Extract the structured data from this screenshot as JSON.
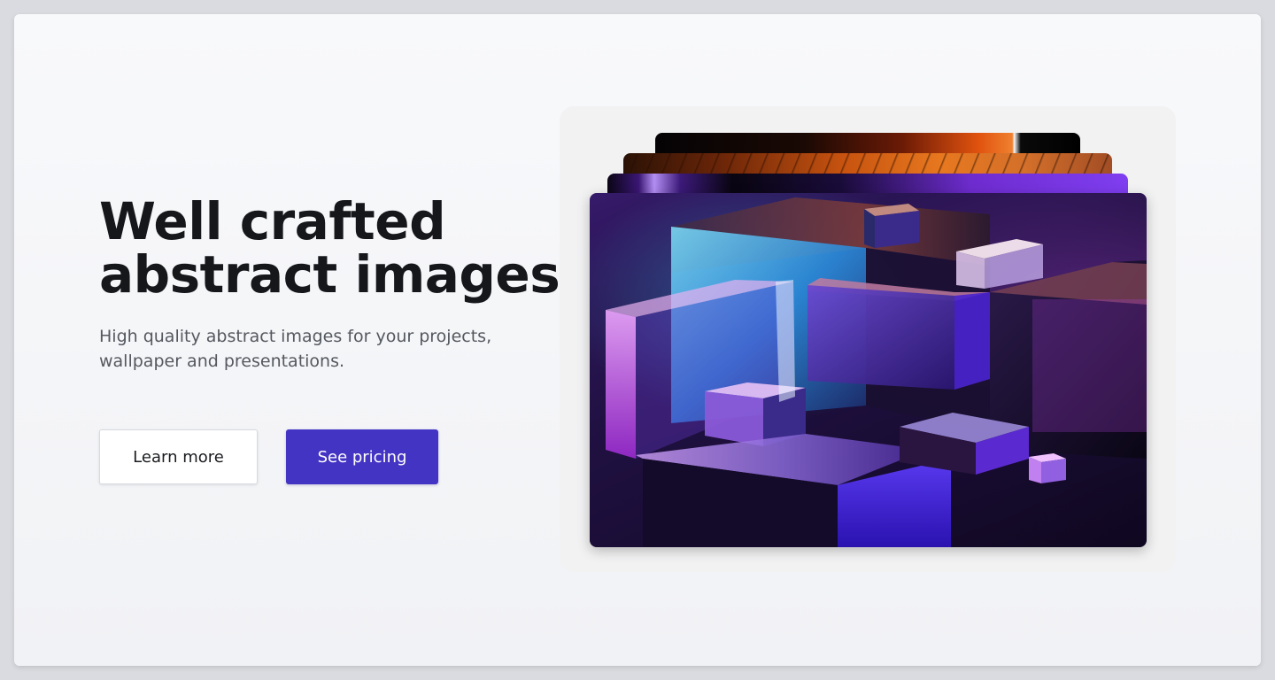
{
  "hero": {
    "title_line1": "Well crafted",
    "title_line2": "abstract images",
    "subtitle_line1": "High quality abstract images for your projects,",
    "subtitle_line2": "wallpaper and presentations."
  },
  "actions": {
    "learn_more_label": "Learn more",
    "see_pricing_label": "See pricing"
  },
  "colors": {
    "primary": "#4434c4",
    "title_text": "#16171b",
    "subtitle_text": "#55585f",
    "background": "#f5f6f8"
  }
}
